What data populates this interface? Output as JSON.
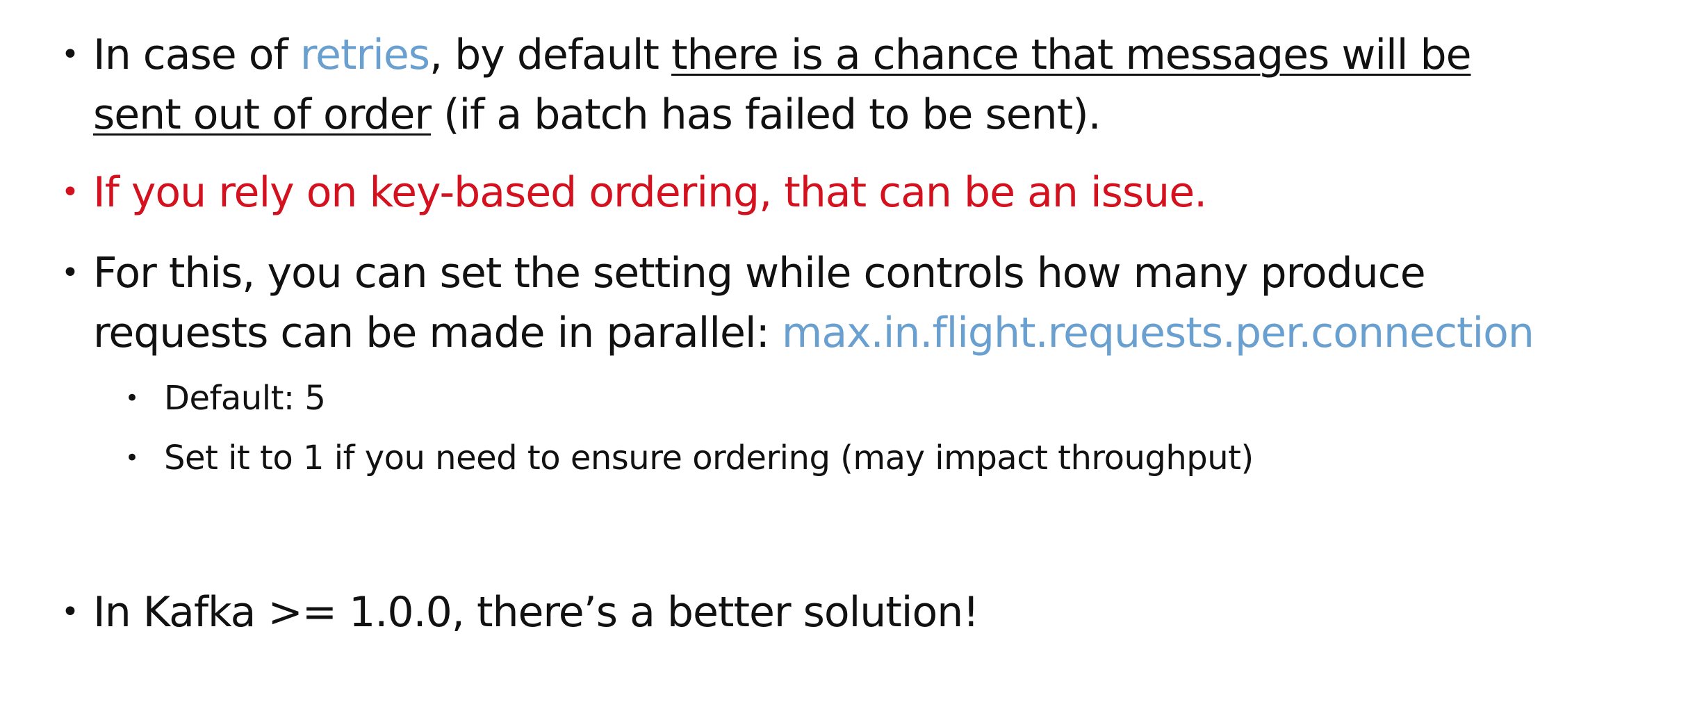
{
  "colors": {
    "text": "#111111",
    "accent_blue": "#6aa0cf",
    "warning_red": "#d4121f",
    "background": "#ffffff"
  },
  "bullets": [
    {
      "parts": {
        "a": "In case of ",
        "b": "retries",
        "c": ", by default ",
        "d": "there is a chance that messages will be",
        "e": "sent out of order",
        "f": " (if a batch has failed to be sent)."
      }
    },
    {
      "text": "If you rely on key-based ordering, that can be an issue."
    },
    {
      "parts": {
        "a": "For this, you can set the setting while controls how many produce",
        "b": "requests can be made in parallel: ",
        "c": "max.in.flight.requests.per.connection"
      },
      "sub": [
        {
          "text": "Default: 5"
        },
        {
          "text": "Set it to 1 if you need to ensure ordering (may impact throughput)"
        }
      ]
    },
    {
      "text": "In Kafka >= 1.0.0, there’s a better solution!"
    }
  ],
  "bullet_char": "•"
}
